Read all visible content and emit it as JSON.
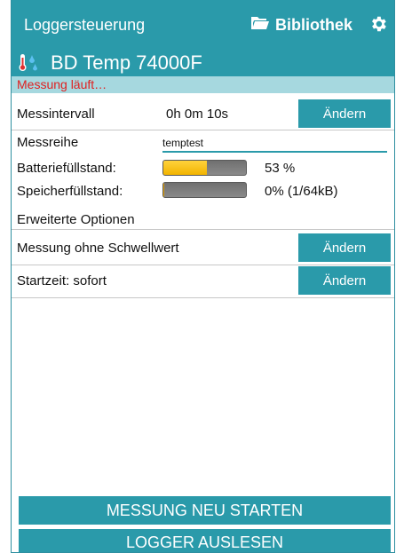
{
  "app": {
    "title": "Loggersteuerung",
    "library_label": "Bibliothek"
  },
  "device": {
    "name": "BD Temp 74000F"
  },
  "status": {
    "text": "Messung läuft…"
  },
  "settings": {
    "interval_label": "Messintervall",
    "interval_value": "0h 0m 10s",
    "change_label": "Ändern",
    "series_label": "Messreihe",
    "series_value": "temptest",
    "battery_label": "Batteriefüllstand:",
    "battery_percent": 53,
    "battery_text": "53 %",
    "memory_label": "Speicherfüllstand:",
    "memory_percent": 1,
    "memory_text": "0% (1/64kB)",
    "advanced_label": "Erweiterte Optionen",
    "threshold_label": "Messung ohne Schwellwert",
    "start_label": "Startzeit: sofort"
  },
  "actions": {
    "restart_label": "MESSUNG NEU STARTEN",
    "read_label": "LOGGER AUSLESEN"
  },
  "colors": {
    "accent": "#2a9aaa",
    "status_bg": "#a6d8df",
    "status_text": "#e02020",
    "battery_fill": "#f2b400"
  },
  "icons": {
    "library": "folder-icon",
    "settings": "gear-icon",
    "device": "thermometer-icon"
  }
}
